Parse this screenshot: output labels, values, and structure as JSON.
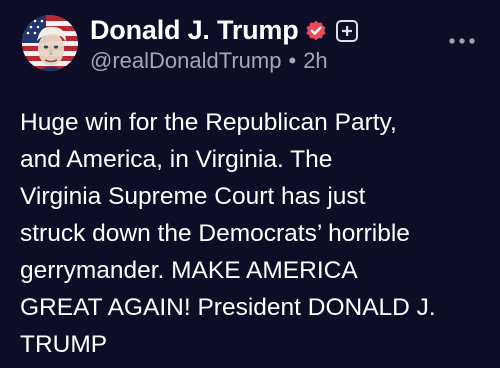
{
  "post": {
    "author": {
      "display_name": "Donald J. Trump",
      "handle": "@realDonaldTrump",
      "time_ago": "2h",
      "separator": "•",
      "avatar": "avatar-image",
      "badges": [
        "verified-badge-icon",
        "plus-badge-icon"
      ]
    },
    "more_icon": "more-options-icon",
    "text": "Huge win for the Republican Party,\nand America, in Virginia. The\nVirginia Supreme Court has just\nstruck down the Democrats’ horrible\ngerrymander. MAKE AMERICA\nGREAT AGAIN! President DONALD J.\nTRUMP"
  },
  "colors": {
    "background": "#0d0d27",
    "text": "#ffffff",
    "secondary_text": "#a5a6b8",
    "verified_badge": "#ec4a5a"
  }
}
